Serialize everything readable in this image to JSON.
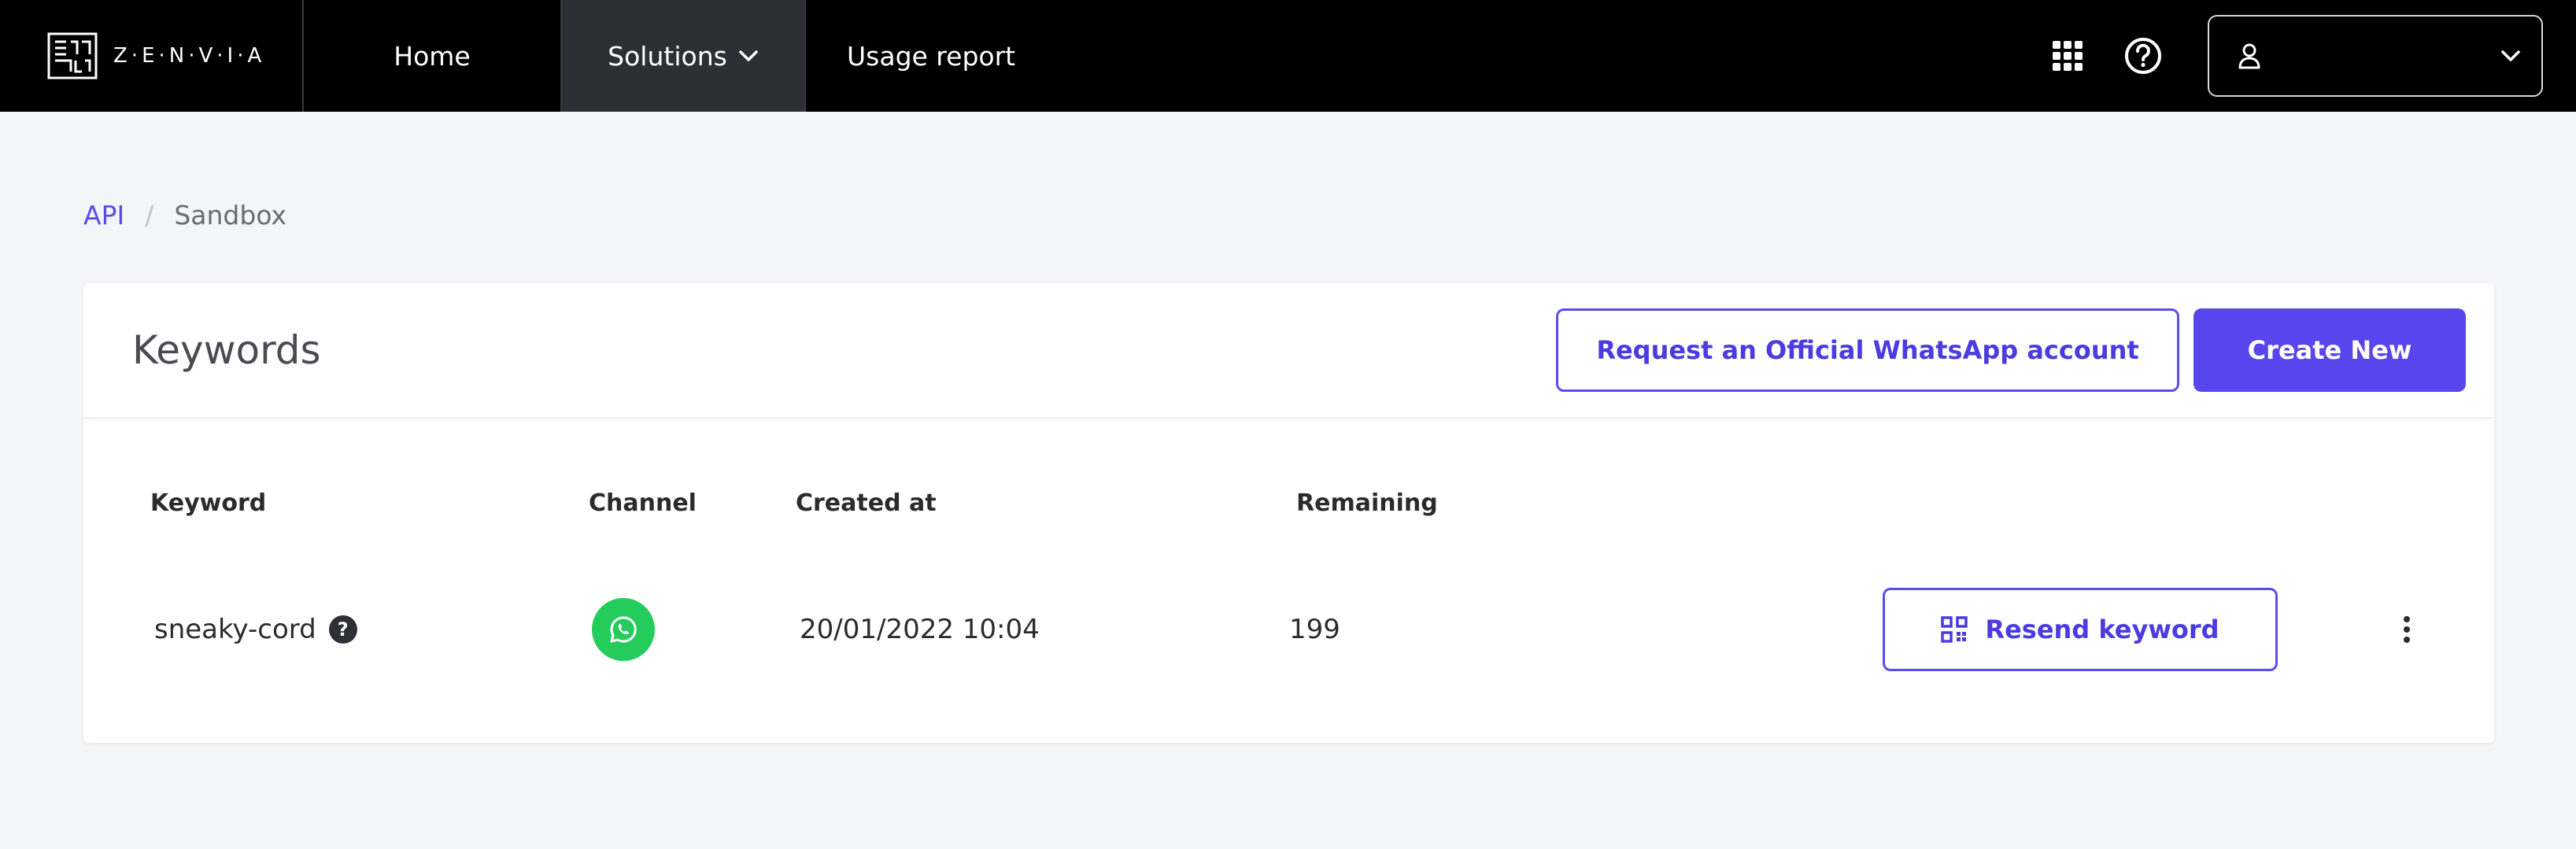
{
  "brand": {
    "logo_text": "Z·E·N·V·I·A",
    "accent_color": "#5746ee",
    "nav_background": "#000000",
    "whatsapp_color": "#24cc5b"
  },
  "nav": {
    "home_label": "Home",
    "solutions_label": "Solutions",
    "usage_label": "Usage report",
    "icons": [
      "apps-grid-icon",
      "help-circle-icon",
      "user-icon",
      "chevron-down-icon"
    ],
    "user_name": ""
  },
  "breadcrumb": {
    "root": "API",
    "separator": "/",
    "current": "Sandbox"
  },
  "card": {
    "title": "Keywords",
    "request_button_label": "Request an Official WhatsApp account",
    "create_button_label": "Create New"
  },
  "table": {
    "columns": [
      "Keyword",
      "Channel",
      "Created at",
      "Remaining"
    ],
    "rows": [
      {
        "keyword": "sneaky-cord",
        "help_icon": "?",
        "channel_icon": "whatsapp-icon",
        "created_at": "20/01/2022 10:04",
        "remaining": "199",
        "resend_label": "Resend keyword"
      }
    ]
  }
}
